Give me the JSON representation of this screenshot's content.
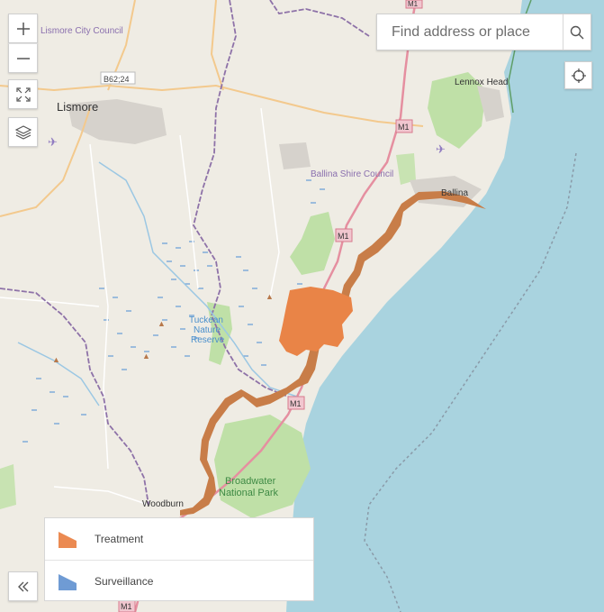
{
  "search": {
    "placeholder": "Find address or place"
  },
  "map_labels": {
    "lismore_council": "Lismore City Council",
    "lismore": "Lismore",
    "b62": "B62;24",
    "lennox_head": "Lennox Head",
    "m1_north": "M1",
    "m1_mid": "M1",
    "m1_south": "M1",
    "m1_bottom": "M1",
    "ballina_council": "Ballina Shire Council",
    "ballina": "Ballina",
    "tuckean_1": "Tuckean",
    "tuckean_2": "Nature",
    "tuckean_3": "Reserve",
    "broadwater_1": "Broadwater",
    "broadwater_2": "National Park",
    "woodburn": "Woodburn",
    "top_m1": "M1"
  },
  "legend": {
    "items": [
      {
        "label": "Treatment",
        "color": "#eb8a52"
      },
      {
        "label": "Surveillance",
        "color": "#6f9bd4"
      }
    ]
  },
  "colors": {
    "land": "#efece4",
    "sea": "#a9d3df",
    "park": "#bfe0a7",
    "treatment": "#e98447",
    "river_band": "#c87d48",
    "motorway": "#e58fa0",
    "boundary": "#8e72a8"
  },
  "icons": [
    "plus-icon",
    "minus-icon",
    "fullscreen-icon",
    "layers-icon",
    "search-icon",
    "locate-icon",
    "double-chevron-left-icon"
  ]
}
